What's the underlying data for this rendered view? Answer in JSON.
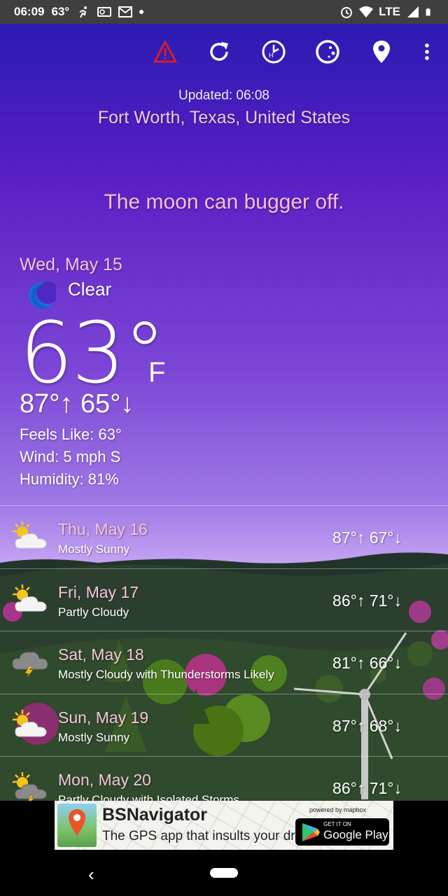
{
  "status_bar": {
    "time": "06:09",
    "temp": "63°",
    "network": "LTE"
  },
  "toolbar": {
    "icons": [
      "warning-icon",
      "refresh-icon",
      "history-icon",
      "moon-phase-icon",
      "location-pin-icon",
      "overflow-menu-icon"
    ],
    "warning_color": "#d0202a"
  },
  "header": {
    "updated": "Updated: 06:08",
    "location": "Fort Worth, Texas, United States",
    "snark": "The moon can bugger off."
  },
  "current": {
    "date": "Wed, May 15",
    "condition": "Clear",
    "condition_icon": "moon-icon",
    "temp": "63°",
    "unit": "F",
    "hilo": "87°↑ 65°↓",
    "feels_like": "Feels Like: 63°",
    "wind": "Wind: 5 mph S",
    "humidity": "Humidity: 81%"
  },
  "forecast": [
    {
      "day": "Thu, May 16",
      "desc": "Mostly Sunny",
      "temps": "87°↑ 67°↓",
      "icon": "partly-sunny-icon"
    },
    {
      "day": "Fri, May 17",
      "desc": "Partly Cloudy",
      "temps": "86°↑ 71°↓",
      "icon": "partly-cloudy-icon"
    },
    {
      "day": "Sat, May 18",
      "desc": "Mostly Cloudy with Thunderstorms Likely",
      "temps": "81°↑ 66°↓",
      "icon": "thunderstorm-icon"
    },
    {
      "day": "Sun, May 19",
      "desc": "Mostly Sunny",
      "temps": "87°↑ 68°↓",
      "icon": "partly-sunny-icon"
    },
    {
      "day": "Mon, May 20",
      "desc": "Partly Cloudy with Isolated Storms",
      "temps": "86°↑ 71°↓",
      "icon": "sun-storm-icon"
    }
  ],
  "ad": {
    "title": "BSNavigator",
    "subtitle": "The GPS app that insults your driving.",
    "powered_by": "powered by mapbox",
    "store_small": "GET IT ON",
    "store_big": "Google Play"
  },
  "colors": {
    "sky_top": "#2b1bb2",
    "sky_bottom": "#caa7f5",
    "date_pink": "#f6c4db"
  }
}
